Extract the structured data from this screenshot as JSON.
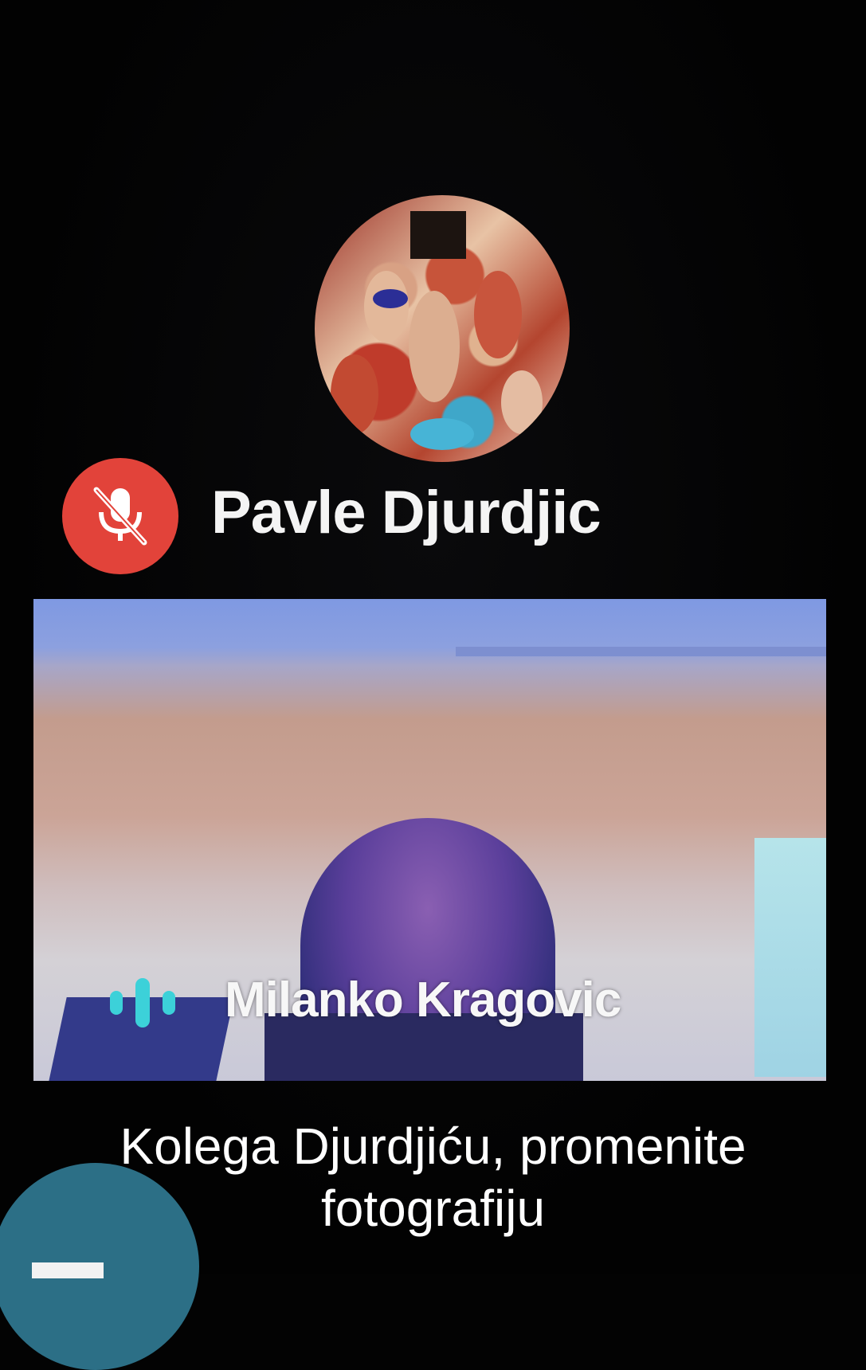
{
  "participants": [
    {
      "name": "Pavle Djurdjic",
      "mic_state": "muted",
      "icon": "mic-off-icon",
      "badge_color": "#e2433a"
    },
    {
      "name": "Milanko Kragovic",
      "mic_state": "speaking",
      "icon": "audio-level-icon",
      "indicator_color": "#3cd1d9"
    }
  ],
  "caption": {
    "line1": "Kolega Djurdjiću, promenite",
    "line2": "fotografiju"
  },
  "colors": {
    "background": "#030303",
    "text": "#ffffff"
  }
}
